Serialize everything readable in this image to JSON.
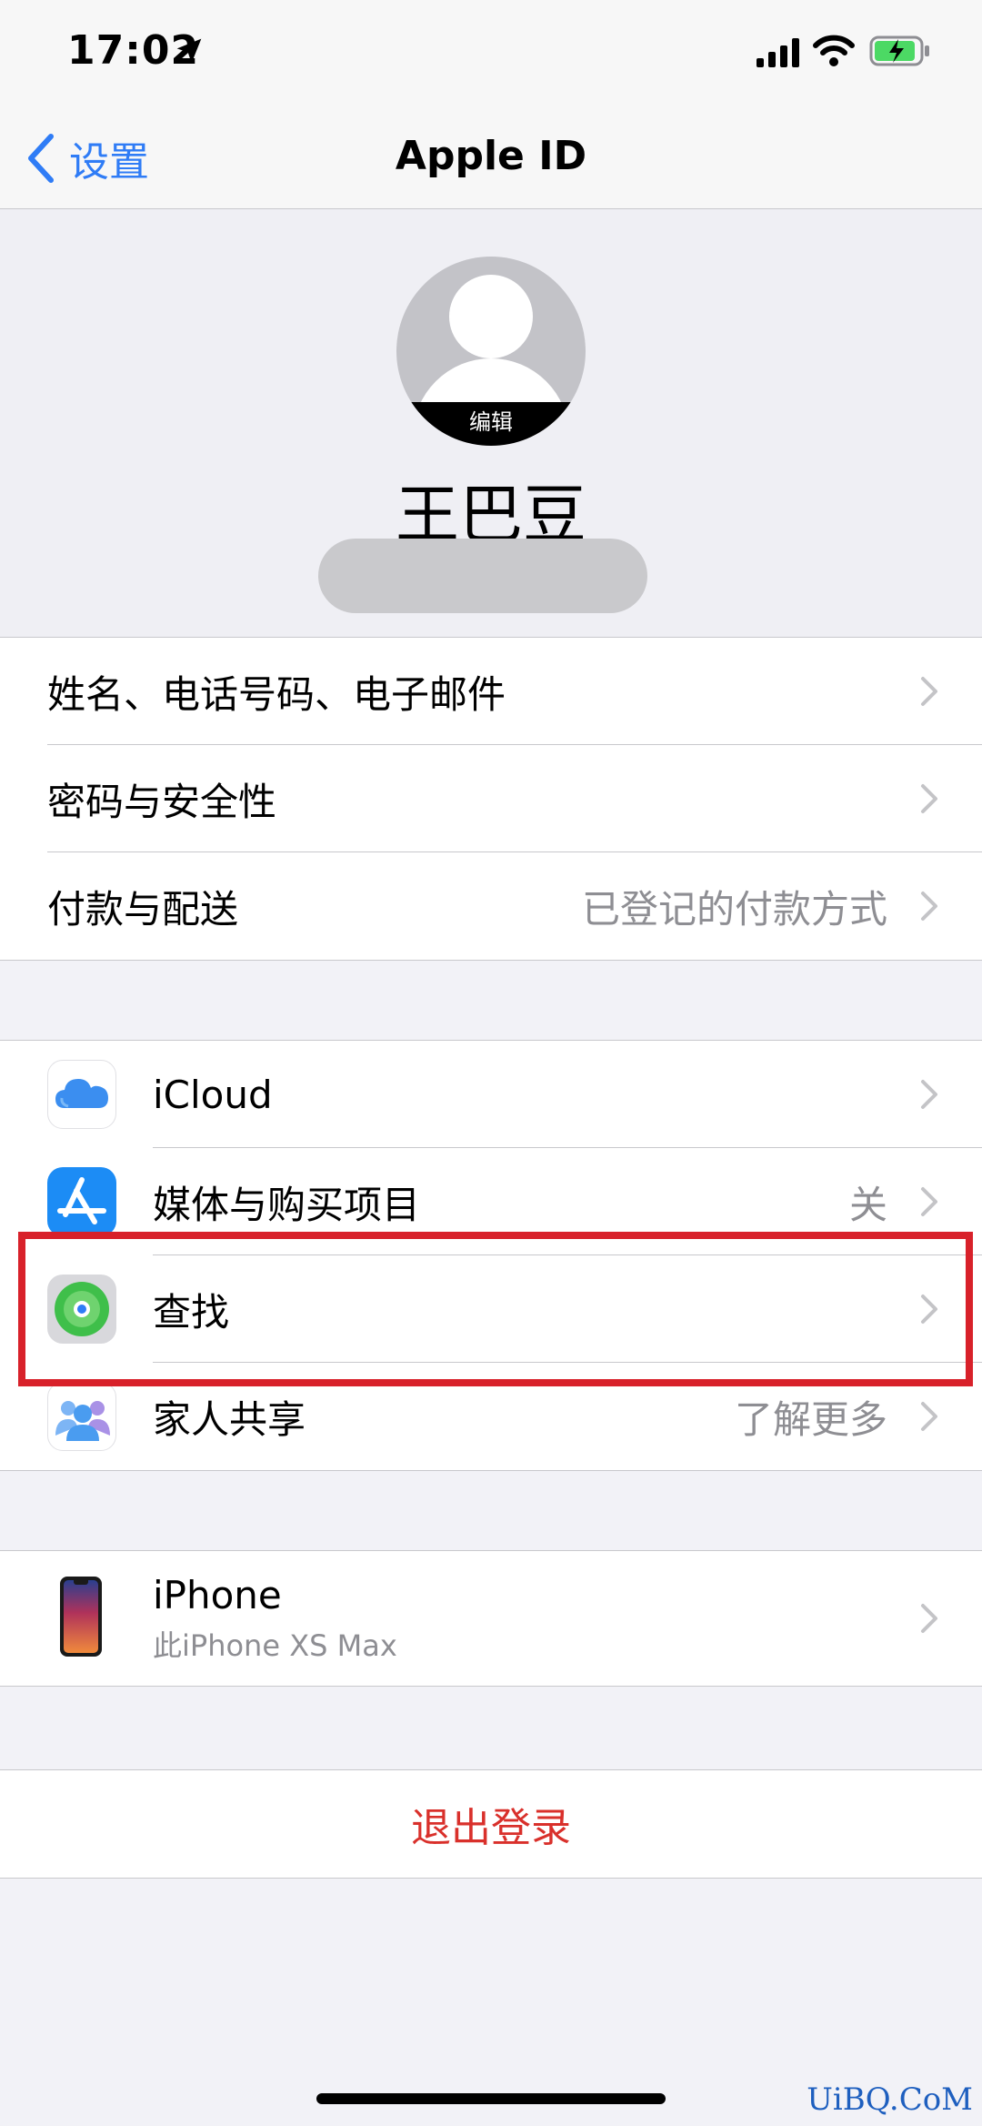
{
  "status_bar": {
    "time": "17:02",
    "location_icon": "location-arrow-icon",
    "signal_icon": "cellular-signal-icon",
    "wifi_icon": "wifi-icon",
    "battery_icon": "battery-charging-icon",
    "battery_color": "#4cd964"
  },
  "nav": {
    "back_label": "设置",
    "title": "Apple ID",
    "accent": "#2f7cf6"
  },
  "profile": {
    "edit_label": "编辑",
    "name": "王巴豆"
  },
  "account_group": [
    {
      "label": "姓名、电话号码、电子邮件",
      "detail": ""
    },
    {
      "label": "密码与安全性",
      "detail": ""
    },
    {
      "label": "付款与配送",
      "detail": "已登记的付款方式"
    }
  ],
  "services_group": [
    {
      "icon": "icloud-icon",
      "label": "iCloud",
      "detail": ""
    },
    {
      "icon": "app-store-icon",
      "label": "媒体与购买项目",
      "detail": "关"
    },
    {
      "icon": "find-my-icon",
      "label": "查找",
      "detail": ""
    },
    {
      "icon": "family-sharing-icon",
      "label": "家人共享",
      "detail": "了解更多"
    }
  ],
  "device": {
    "icon": "iphone-device-icon",
    "name": "iPhone",
    "subtitle": "此iPhone XS Max"
  },
  "signout_label": "退出登录",
  "highlight_color": "#d8212a",
  "watermark": "UiBQ.CoM"
}
